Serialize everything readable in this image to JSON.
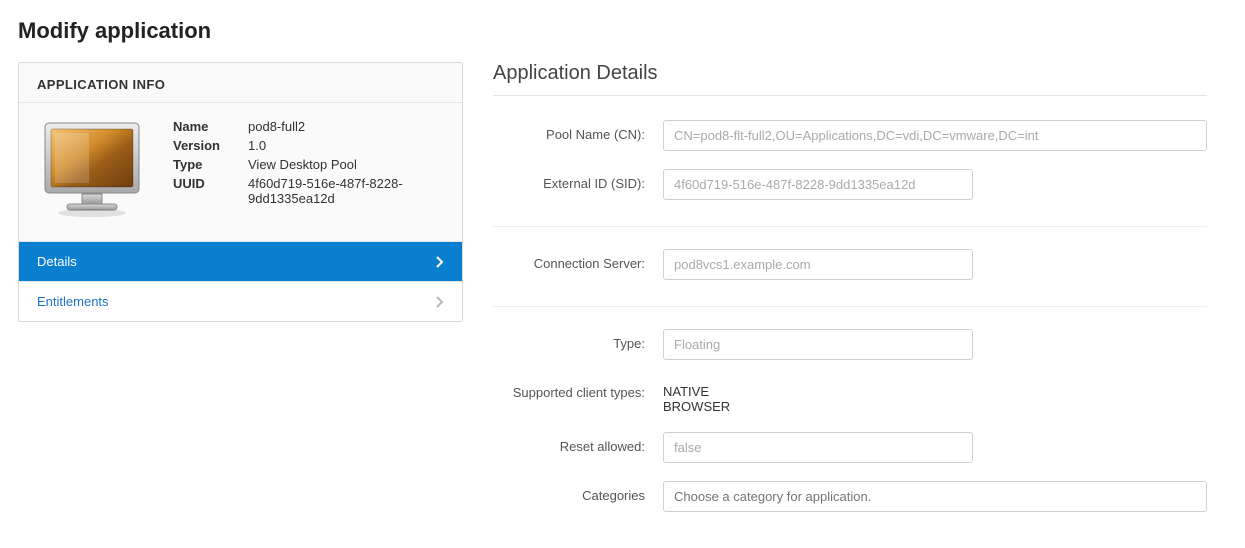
{
  "page": {
    "title": "Modify application"
  },
  "info_card": {
    "header": "APPLICATION INFO",
    "icon": "desktop-monitor-icon",
    "fields": {
      "name": {
        "label": "Name",
        "value": "pod8-full2"
      },
      "version": {
        "label": "Version",
        "value": "1.0"
      },
      "type": {
        "label": "Type",
        "value": "View Desktop Pool"
      },
      "uuid": {
        "label": "UUID",
        "value": "4f60d719-516e-487f-8228-9dd1335ea12d"
      }
    },
    "nav": {
      "details": "Details",
      "entitlements": "Entitlements"
    }
  },
  "details": {
    "section_title": "Application Details",
    "pool_name": {
      "label": "Pool Name (CN):",
      "value": "CN=pod8-flt-full2,OU=Applications,DC=vdi,DC=vmware,DC=int"
    },
    "external_id": {
      "label": "External ID (SID):",
      "value": "4f60d719-516e-487f-8228-9dd1335ea12d"
    },
    "connection_server": {
      "label": "Connection Server:",
      "value": "pod8vcs1.example.com"
    },
    "type": {
      "label": "Type:",
      "value": "Floating"
    },
    "supported_client_types": {
      "label": "Supported client types:",
      "value": "NATIVE\nBROWSER"
    },
    "reset_allowed": {
      "label": "Reset allowed:",
      "value": "false"
    },
    "categories": {
      "label": "Categories",
      "placeholder": "Choose a category for application."
    }
  }
}
